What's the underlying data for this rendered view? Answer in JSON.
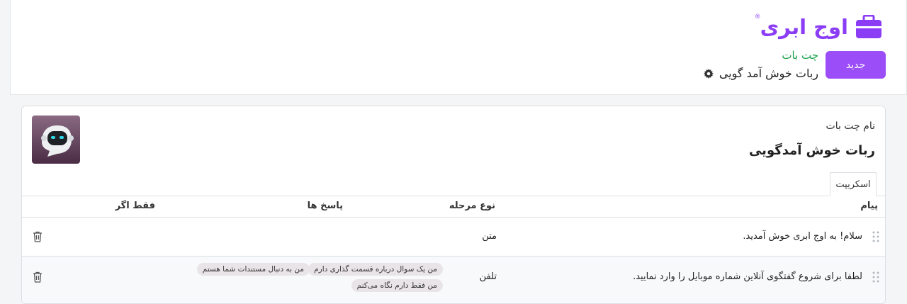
{
  "header": {
    "logo_text": "اوج ابری",
    "logo_reg": "®",
    "new_button": "جدید",
    "section_label": "چت بات",
    "bot_title": "ربات خوش آمد گویی"
  },
  "card": {
    "name_label": "نام چت بات",
    "name_value": "ربات خوش آمدگویی",
    "tab_label": "اسکریپت"
  },
  "table": {
    "headers": {
      "message": "پیام",
      "step_type": "نوع مرحله",
      "answers": "پاسخ ها",
      "only_if": "فقط اگر"
    },
    "rows": [
      {
        "message": "سلام! به اوج ابری خوش آمدید.",
        "step_type": "متن",
        "answers": []
      },
      {
        "message": "لطفا برای شروع گفتگوی آنلاین شماره موبایل را وارد نمایید.",
        "step_type": "تلفن",
        "answers": [
          "من یک سوال درباره قسمت گذاری دارم",
          "من به دنبال مستندات شما هستم",
          "من فقط دارم نگاه می‌کنم"
        ]
      }
    ]
  },
  "colors": {
    "brand": "#8b3df5",
    "button": "#9b4df7",
    "section_label": "#1aa34a",
    "chip_bg": "#e9e4e7"
  },
  "icons": {
    "logo": "briefcase-icon",
    "settings": "gear-icon",
    "drag": "drag-handle-icon",
    "delete": "trash-icon",
    "avatar": "robot-avatar"
  }
}
